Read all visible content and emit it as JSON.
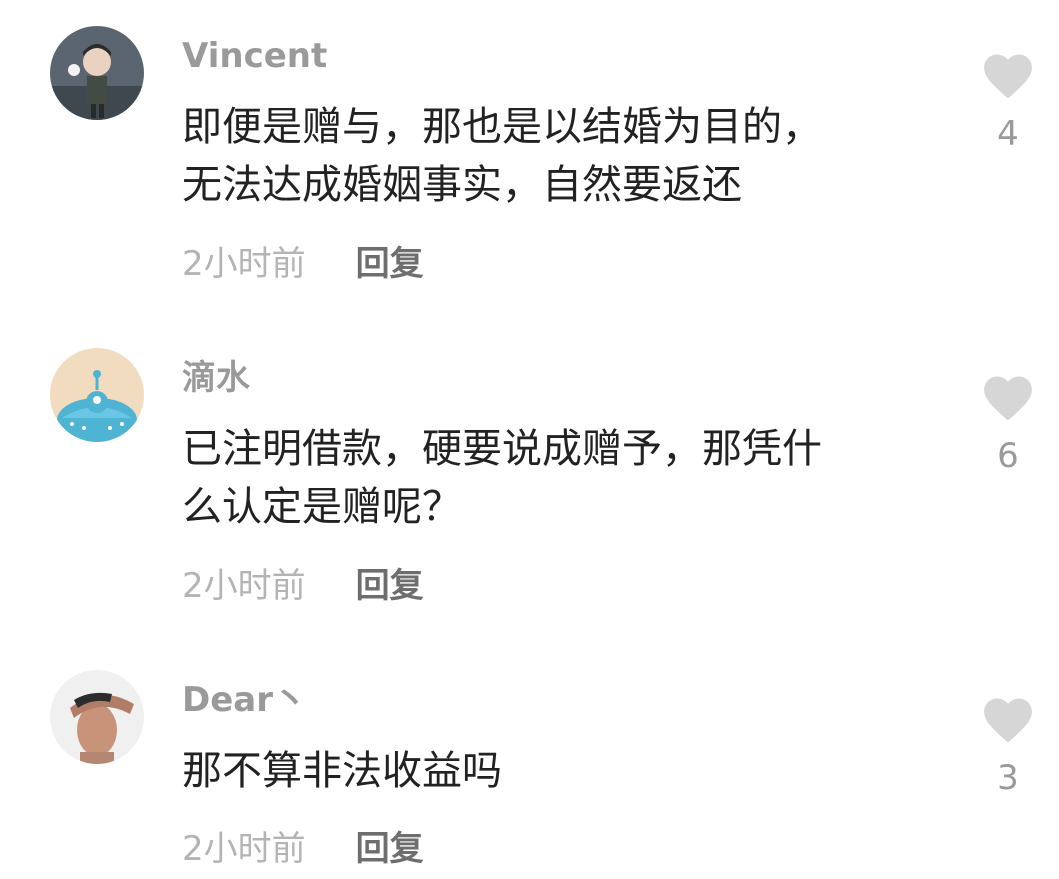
{
  "comments": [
    {
      "username": "Vincent",
      "text_lines": [
        "即便是赠与，那也是以结婚为目的，",
        "无法达成婚姻事实，自然要返还"
      ],
      "time": "2小时前",
      "reply_label": "回复",
      "likes": "4"
    },
    {
      "username": "滴水",
      "text_lines": [
        "已注明借款，硬要说成赠予，那凭什",
        "么认定是赠呢？"
      ],
      "time": "2小时前",
      "reply_label": "回复",
      "likes": "6"
    },
    {
      "username": "Dear丶",
      "text_lines": [
        "那不算非法收益吗"
      ],
      "time": "2小时前",
      "reply_label": "回复",
      "likes": "3"
    }
  ],
  "icons": {
    "like": "heart-icon"
  },
  "colors": {
    "username": "#9a9a9a",
    "text": "#222222",
    "meta": "#b4b4b4",
    "reply": "#6e6e6e",
    "heart": "#d6d6d6"
  }
}
